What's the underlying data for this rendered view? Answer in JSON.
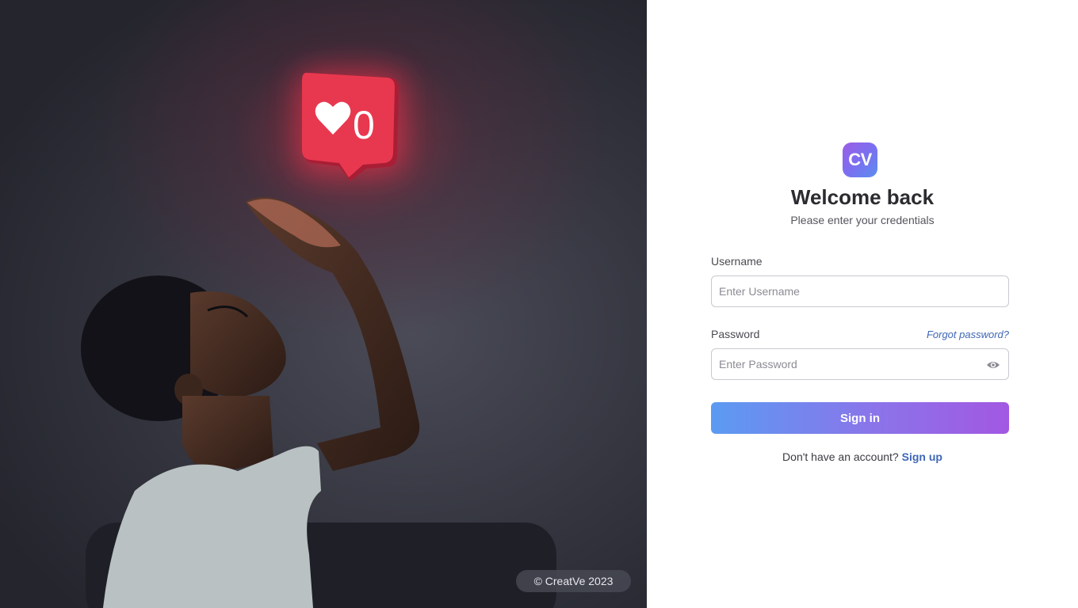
{
  "hero": {
    "image_alt": "",
    "notification": {
      "icon": "heart-icon",
      "count": "0"
    },
    "copyright": "© CreatVe 2023"
  },
  "brand": {
    "logo_text": "CV",
    "colors": {
      "primary": "#7b6ff0",
      "gradient_start": "#5b9bf2",
      "gradient_end": "#a258e2",
      "link": "#3f67b5"
    }
  },
  "form": {
    "title": "Welcome back",
    "subtitle": "Please enter your credentials",
    "username": {
      "label": "Username",
      "placeholder": "Enter Username",
      "value": ""
    },
    "password": {
      "label": "Password",
      "placeholder": "Enter Password",
      "value": "",
      "toggle_icon": "eye-icon"
    },
    "forgot_label": "Forgot password?",
    "submit_label": "Sign in",
    "signup_prompt": "Don't have an account?",
    "signup_label": "Sign up"
  }
}
